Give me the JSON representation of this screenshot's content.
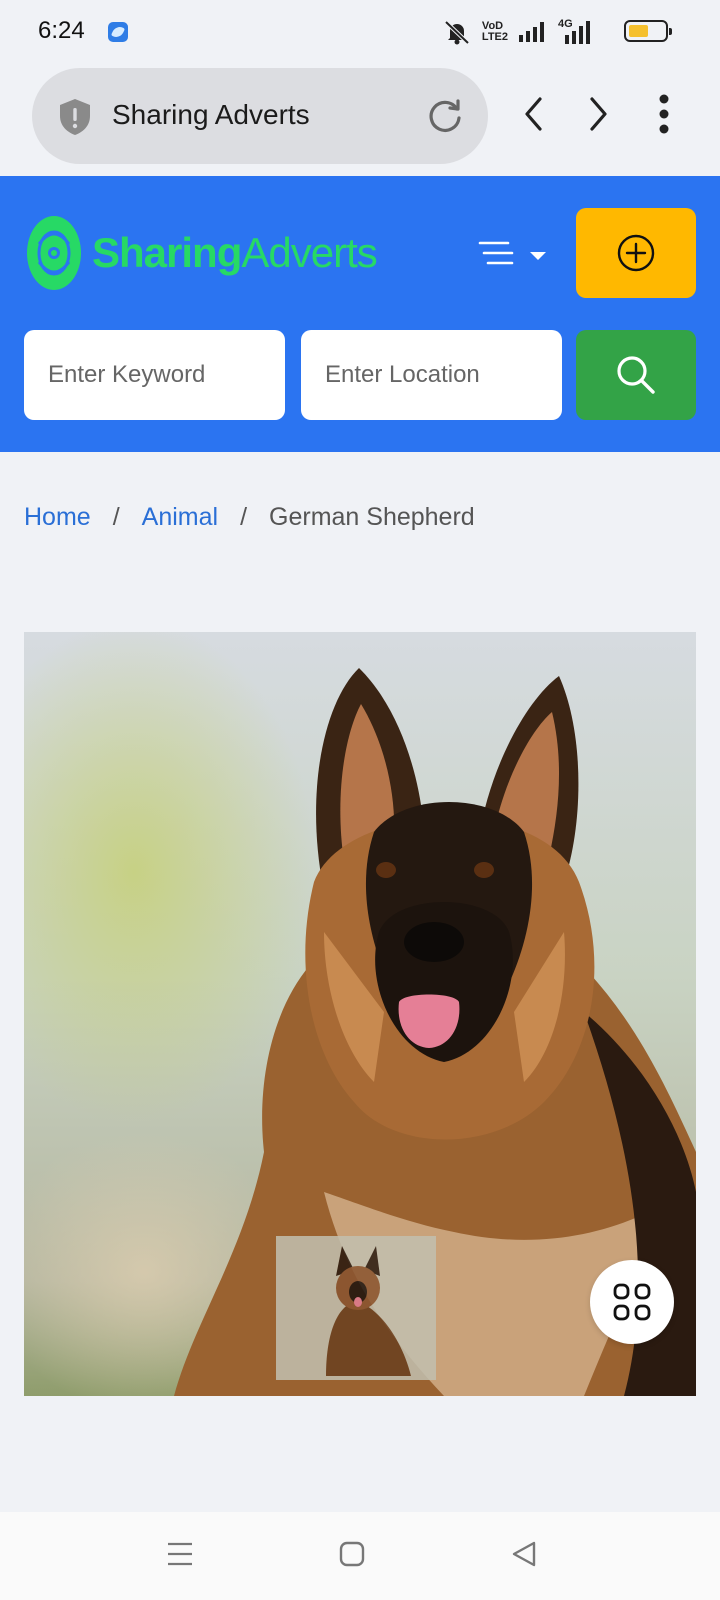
{
  "status_bar": {
    "time": "6:24",
    "network_label_top": "VoD",
    "network_label_bottom": "LTE2",
    "data_label": "4G",
    "battery_level": 0.55
  },
  "browser": {
    "page_title": "Sharing Adverts"
  },
  "header": {
    "logo_part1": "Sharing",
    "logo_part2": "Adverts",
    "keyword_placeholder": "Enter Keyword",
    "location_placeholder": "Enter Location"
  },
  "breadcrumb": {
    "home": "Home",
    "category": "Animal",
    "separator": "/",
    "current": "German Shepherd"
  },
  "colors": {
    "header_bg": "#2b74f1",
    "logo_green": "#27d965",
    "post_button": "#ffb800",
    "search_button": "#33a347",
    "link_blue": "#2a6fd6"
  },
  "icons": [
    "shield-icon",
    "reload-icon",
    "back-icon",
    "forward-icon",
    "more-icon",
    "menu-icon",
    "add-circle-icon",
    "search-icon",
    "grid-icon"
  ]
}
